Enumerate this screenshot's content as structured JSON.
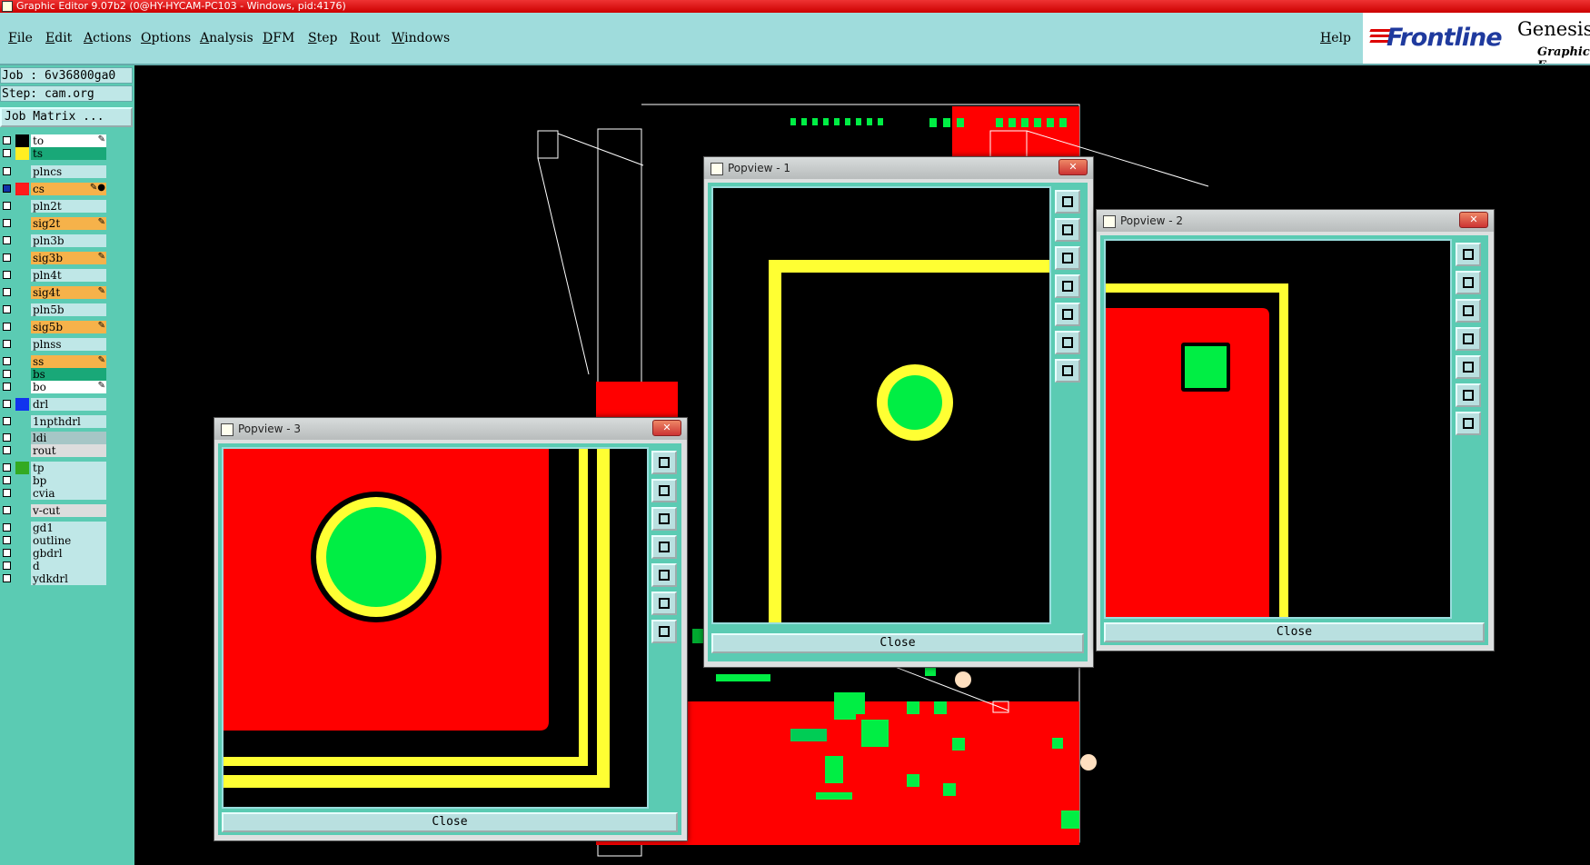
{
  "window": {
    "title": "Graphic Editor 9.07b2 (0@HY-HYCAM-PC103 - Windows, pid:4176)"
  },
  "menu": {
    "items": [
      "File",
      "Edit",
      "Actions",
      "Options",
      "Analysis",
      "DFM",
      "Step",
      "Rout",
      "Windows"
    ],
    "help": "Help"
  },
  "brand": {
    "logo": "Frontline",
    "product": "Genesis",
    "subtitle": "Graphic E"
  },
  "job": {
    "job_line": "Job : 6v36800ga0",
    "step_line": "Step: cam.org",
    "matrix_button": "Job Matrix ..."
  },
  "layers": [
    {
      "name": "to",
      "swatch": "#000000",
      "fill": "#ffffff",
      "mark": "✎",
      "checked": false
    },
    {
      "name": "ts",
      "swatch": "#ffee22",
      "fill": "#19a878",
      "mark": "",
      "checked": false
    },
    {
      "name": "plncs",
      "swatch": "",
      "fill": "#bfe7e7",
      "mark": "",
      "checked": false
    },
    {
      "name": "cs",
      "swatch": "#ff1a1a",
      "fill": "#f6b24a",
      "mark": "✎●",
      "checked": true
    },
    {
      "name": "pln2t",
      "swatch": "",
      "fill": "#bfe7e7",
      "mark": "",
      "checked": false
    },
    {
      "name": "sig2t",
      "swatch": "",
      "fill": "#f6b24a",
      "mark": "✎",
      "checked": false
    },
    {
      "name": "pln3b",
      "swatch": "",
      "fill": "#bfe7e7",
      "mark": "",
      "checked": false
    },
    {
      "name": "sig3b",
      "swatch": "",
      "fill": "#f6b24a",
      "mark": "✎",
      "checked": false
    },
    {
      "name": "pln4t",
      "swatch": "",
      "fill": "#bfe7e7",
      "mark": "",
      "checked": false
    },
    {
      "name": "sig4t",
      "swatch": "",
      "fill": "#f6b24a",
      "mark": "✎",
      "checked": false
    },
    {
      "name": "pln5b",
      "swatch": "",
      "fill": "#bfe7e7",
      "mark": "",
      "checked": false
    },
    {
      "name": "sig5b",
      "swatch": "",
      "fill": "#f6b24a",
      "mark": "✎",
      "checked": false
    },
    {
      "name": "plnss",
      "swatch": "",
      "fill": "#bfe7e7",
      "mark": "",
      "checked": false
    },
    {
      "name": "ss",
      "swatch": "",
      "fill": "#f6b24a",
      "mark": "✎",
      "checked": false
    },
    {
      "name": "bs",
      "swatch": "",
      "fill": "#19a878",
      "mark": "",
      "checked": false
    },
    {
      "name": "bo",
      "swatch": "",
      "fill": "#ffffff",
      "mark": "✎",
      "checked": false
    },
    {
      "name": "drl",
      "swatch": "#1133ee",
      "fill": "#bfe7e7",
      "mark": "",
      "checked": false
    },
    {
      "name": "1npthdrl",
      "swatch": "",
      "fill": "#bfe7e7",
      "mark": "",
      "checked": false
    },
    {
      "name": "ldi",
      "swatch": "",
      "fill": "#a6c6c6",
      "mark": "",
      "checked": false
    },
    {
      "name": "rout",
      "swatch": "",
      "fill": "#dddddd",
      "mark": "",
      "checked": false
    },
    {
      "name": "tp",
      "swatch": "#33aa22",
      "fill": "#bfe7e7",
      "mark": "",
      "checked": false
    },
    {
      "name": "bp",
      "swatch": "",
      "fill": "#bfe7e7",
      "mark": "",
      "checked": false
    },
    {
      "name": "cvia",
      "swatch": "",
      "fill": "#bfe7e7",
      "mark": "",
      "checked": false
    },
    {
      "name": "v-cut",
      "swatch": "",
      "fill": "#dddddd",
      "mark": "",
      "checked": false
    },
    {
      "name": "gd1",
      "swatch": "",
      "fill": "#bfe7e7",
      "mark": "",
      "checked": false
    },
    {
      "name": "outline",
      "swatch": "",
      "fill": "#bfe7e7",
      "mark": "",
      "checked": false
    },
    {
      "name": "gbdrl",
      "swatch": "",
      "fill": "#bfe7e7",
      "mark": "",
      "checked": false
    },
    {
      "name": "d",
      "swatch": "",
      "fill": "#bfe7e7",
      "mark": "",
      "checked": false
    },
    {
      "name": "ydkdrl",
      "swatch": "",
      "fill": "#bfe7e7",
      "mark": "",
      "checked": false
    }
  ],
  "popups": [
    {
      "title": "Popview - 1",
      "close_label": "Close"
    },
    {
      "title": "Popview - 2",
      "close_label": "Close"
    },
    {
      "title": "Popview - 3",
      "close_label": "Close"
    }
  ],
  "colors": {
    "copper": "#ff0000",
    "pad": "#00ee44",
    "silk": "#ffff33",
    "panel": "#5bcbb3",
    "menu": "#9fdcdc"
  },
  "icons": {
    "tool_buttons": [
      "zoom-window-icon",
      "pan-up-icon",
      "pan-down-icon",
      "pan-left-icon",
      "pan-right-icon",
      "zoom-fit-icon",
      "zoom-home-icon"
    ]
  }
}
